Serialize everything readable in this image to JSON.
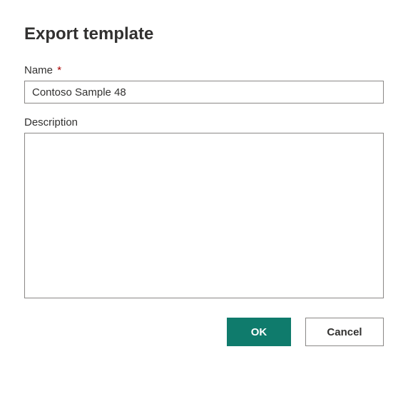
{
  "dialog": {
    "title": "Export template",
    "fields": {
      "name": {
        "label": "Name",
        "required_marker": "*",
        "value": "Contoso Sample 48"
      },
      "description": {
        "label": "Description",
        "value": ""
      }
    },
    "buttons": {
      "ok": "OK",
      "cancel": "Cancel"
    },
    "colors": {
      "primary": "#0f7b6c",
      "required": "#a80000",
      "border": "#8a8886",
      "text": "#323130"
    }
  }
}
